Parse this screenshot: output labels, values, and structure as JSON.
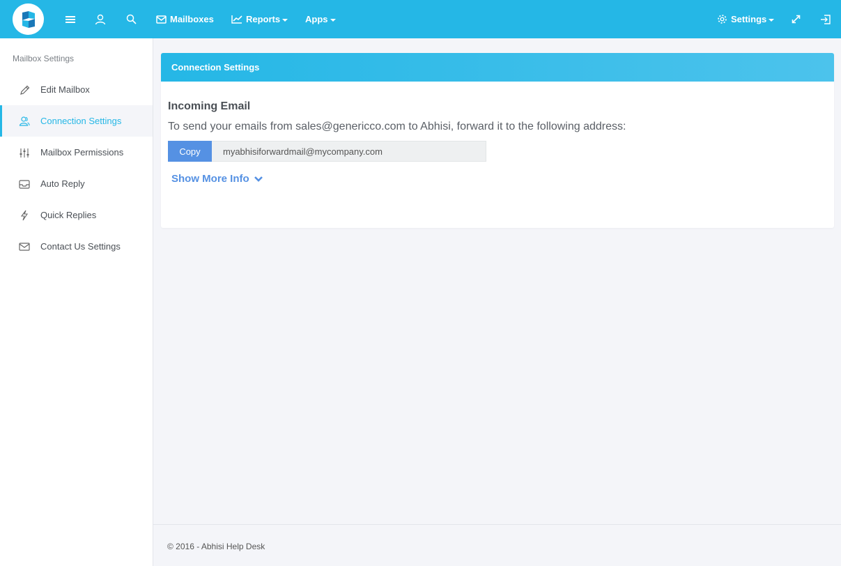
{
  "nav": {
    "mailboxes": "Mailboxes",
    "reports": "Reports",
    "apps": "Apps",
    "settings": "Settings"
  },
  "sidebar": {
    "title": "Mailbox Settings",
    "items": [
      {
        "label": "Edit Mailbox",
        "icon": "pencil-icon"
      },
      {
        "label": "Connection Settings",
        "icon": "users-icon",
        "active": true
      },
      {
        "label": "Mailbox Permissions",
        "icon": "sliders-icon"
      },
      {
        "label": "Auto Reply",
        "icon": "inbox-icon"
      },
      {
        "label": "Quick Replies",
        "icon": "bolt-icon"
      },
      {
        "label": "Contact Us Settings",
        "icon": "envelope-icon"
      }
    ]
  },
  "panel": {
    "header": "Connection Settings",
    "incoming_title": "Incoming Email",
    "incoming_desc": "To send your emails from sales@genericco.com to Abhisi, forward it to the following address:",
    "copy_label": "Copy",
    "forward_address": "myabhisiforwardmail@mycompany.com",
    "more_info": "Show More Info"
  },
  "footer": "© 2016 - Abhisi  Help Desk",
  "colors": {
    "accent": "#25b7e6",
    "link": "#5591e3"
  }
}
